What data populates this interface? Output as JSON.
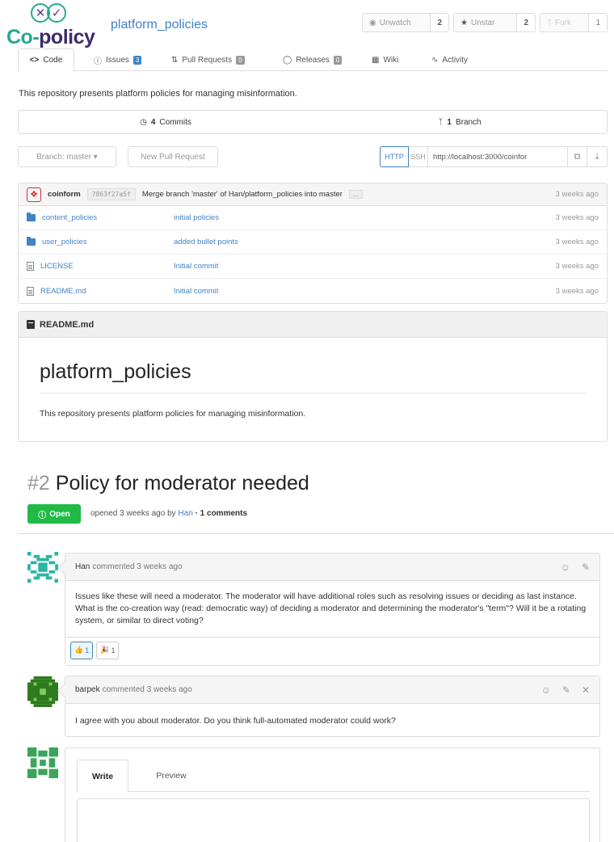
{
  "header": {
    "logo_text_a": "Co-",
    "logo_text_b": "policy",
    "logo_marks": [
      "✕",
      "✓"
    ],
    "repo_name": "platform_policies",
    "watch_label": "Unwatch",
    "watch_count": "2",
    "star_label": "Unstar",
    "star_count": "2",
    "fork_label": "Fork",
    "fork_count": "1"
  },
  "tabs": [
    {
      "label": "Code"
    },
    {
      "label": "Issues",
      "count": "3"
    },
    {
      "label": "Pull Requests",
      "count": "0"
    },
    {
      "label": "Releases",
      "count": "0"
    },
    {
      "label": "Wiki"
    },
    {
      "label": "Activity"
    }
  ],
  "repo": {
    "description": "This repository presents platform policies for managing misinformation.",
    "commits_count": "4",
    "commits_label": "Commits",
    "branch_count": "1",
    "branch_label": "Branch",
    "branch_selector": "Branch: master ▾",
    "new_pr_label": "New Pull Request",
    "clone_http": "HTTP",
    "clone_ssh": "SSH",
    "clone_url": "http://localhost:3000/coinfor"
  },
  "latest_commit": {
    "author": "coinform",
    "sha": "7863f27a5f",
    "message": "Merge branch 'master' of Han/platform_policies into master",
    "more": "...",
    "time": "3 weeks ago"
  },
  "files": [
    {
      "name": "content_policies",
      "type": "folder",
      "message": "initial policies",
      "time": "3 weeks ago"
    },
    {
      "name": "user_policies",
      "type": "folder",
      "message": "added bullet points",
      "time": "3 weeks ago"
    },
    {
      "name": "LICENSE",
      "type": "file",
      "message": "Initial commit",
      "time": "3 weeks ago"
    },
    {
      "name": "README.md",
      "type": "file",
      "message": "Initial commit",
      "time": "3 weeks ago"
    }
  ],
  "readme": {
    "filename": "README.md",
    "title": "platform_policies",
    "body": "This repository presents platform policies for managing misinformation."
  },
  "issue": {
    "number": "#2",
    "title": "Policy for moderator needed",
    "status": "Open",
    "meta_prefix": "opened 3 weeks ago by",
    "author": "Han",
    "meta_comments": "· 1 comments"
  },
  "comments": [
    {
      "author": "Han",
      "action": "commented 3 weeks ago",
      "body": "Issues like these will need a moderator. The moderator will have additional roles such as resolving issues or deciding as last instance. What is the co-creation way (read: democratic way) of deciding a moderator and determining the moderator's \"term\"? Will it be a rotating system, or similar to direct voting?",
      "reactions": [
        {
          "emoji": "👍",
          "count": "1"
        },
        {
          "emoji": "🎉",
          "count": "1"
        }
      ]
    },
    {
      "author": "barpek",
      "action": "commented 3 weeks ago",
      "body": "I agree with you about moderator. Do you think full-automated moderator could work?"
    }
  ],
  "editor": {
    "write_tab": "Write",
    "preview_tab": "Preview"
  },
  "colors": {
    "accent": "#4183c4",
    "open_green": "#21ba45",
    "logo_teal": "#27a88f",
    "logo_purple": "#3d2c6b"
  }
}
